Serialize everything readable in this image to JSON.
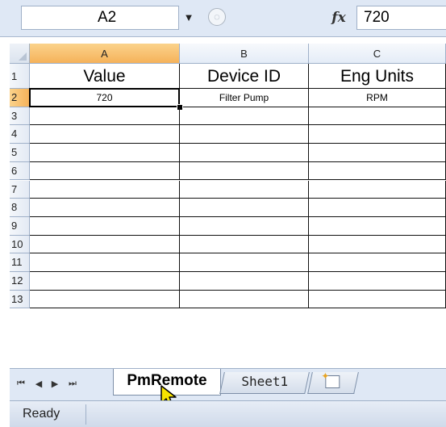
{
  "formula_bar": {
    "name_box": "A2",
    "formula_value": "720",
    "fx_label": "fx",
    "insert_function_glyph": "◌"
  },
  "columns": [
    "A",
    "B",
    "C"
  ],
  "rows": [
    {
      "num": "1",
      "cells": [
        "Value",
        "Device ID",
        "Eng Units"
      ]
    },
    {
      "num": "2",
      "cells": [
        "720",
        "Filter Pump",
        "RPM"
      ]
    },
    {
      "num": "3",
      "cells": [
        "",
        "",
        ""
      ]
    },
    {
      "num": "4",
      "cells": [
        "",
        "",
        ""
      ]
    },
    {
      "num": "5",
      "cells": [
        "",
        "",
        ""
      ]
    },
    {
      "num": "6",
      "cells": [
        "",
        "",
        ""
      ]
    },
    {
      "num": "7",
      "cells": [
        "",
        "",
        ""
      ]
    },
    {
      "num": "8",
      "cells": [
        "",
        "",
        ""
      ]
    },
    {
      "num": "9",
      "cells": [
        "",
        "",
        ""
      ]
    },
    {
      "num": "10",
      "cells": [
        "",
        "",
        ""
      ]
    },
    {
      "num": "11",
      "cells": [
        "",
        "",
        ""
      ]
    },
    {
      "num": "12",
      "cells": [
        "",
        "",
        ""
      ]
    },
    {
      "num": "13",
      "cells": [
        "",
        "",
        ""
      ]
    }
  ],
  "selected": {
    "column": "A",
    "row": "2"
  },
  "sheet_tabs": {
    "nav": [
      "⏮",
      "◀",
      "▶",
      "⏭"
    ],
    "tabs": [
      "PmRemote",
      "Sheet1"
    ],
    "active": "PmRemote"
  },
  "status": {
    "text": "Ready"
  },
  "colors": {
    "selected_header": "#f5b25a",
    "chrome": "#dfe8f5",
    "grid_border": "#111111"
  },
  "icons": [
    "dropdown-arrow-icon",
    "insert-function-icon",
    "fx-icon",
    "new-sheet-icon",
    "mouse-pointer-icon"
  ]
}
